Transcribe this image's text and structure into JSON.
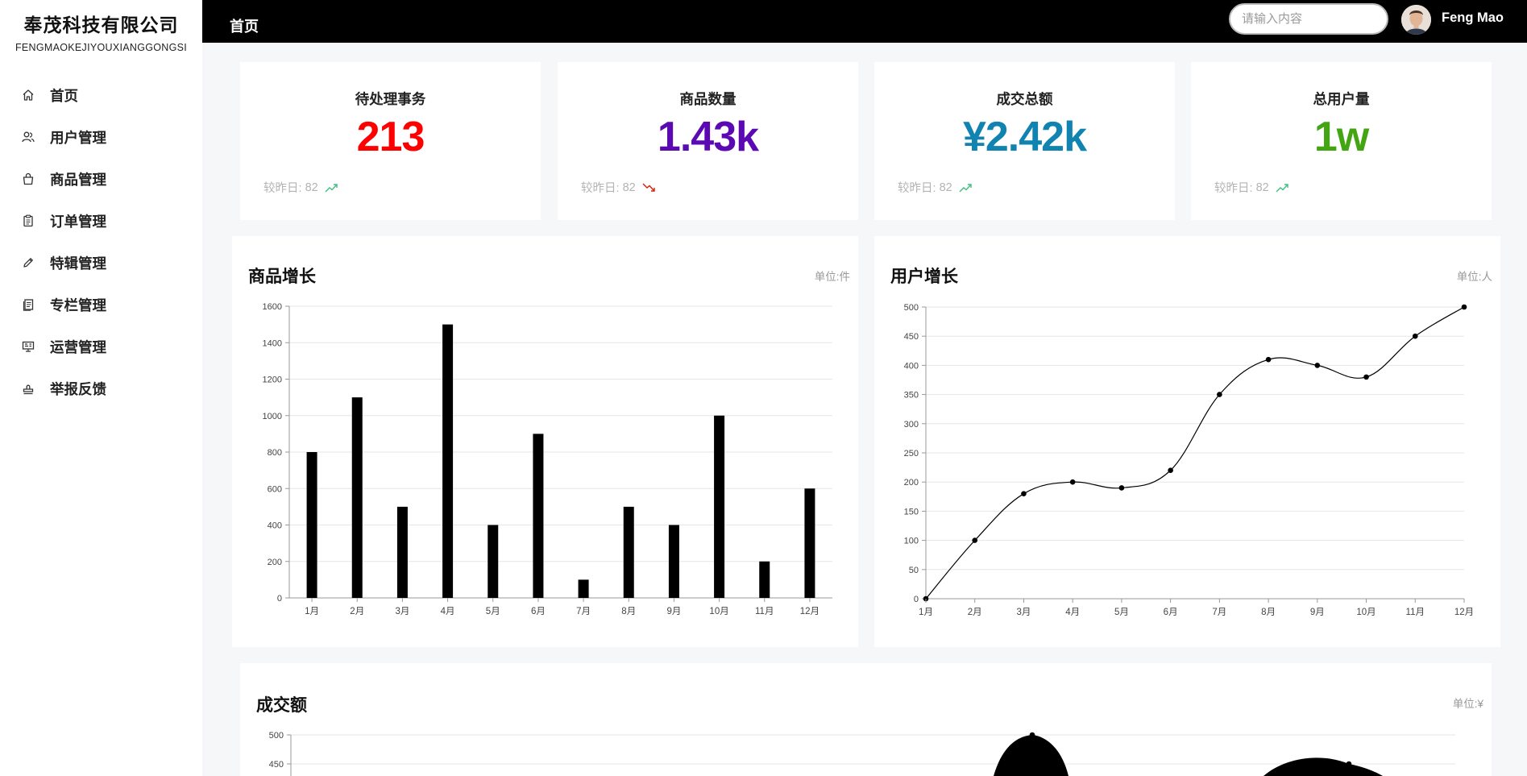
{
  "sidebar": {
    "brand_name": "奉茂科技有限公司",
    "brand_sub": "FENGMAOKEJIYOUXIANGGONGSI",
    "items": [
      {
        "label": "首页",
        "icon": "home-icon"
      },
      {
        "label": "用户管理",
        "icon": "users-icon"
      },
      {
        "label": "商品管理",
        "icon": "bag-icon"
      },
      {
        "label": "订单管理",
        "icon": "clipboard-icon"
      },
      {
        "label": "特辑管理",
        "icon": "pencil-icon"
      },
      {
        "label": "专栏管理",
        "icon": "document-icon"
      },
      {
        "label": "运营管理",
        "icon": "monitor-icon"
      },
      {
        "label": "举报反馈",
        "icon": "stamp-icon"
      }
    ]
  },
  "header": {
    "title": "首页",
    "search_placeholder": "请输入内容",
    "username": "Feng Mao"
  },
  "stats": [
    {
      "title": "待处理事务",
      "value": "213",
      "color": "#ff0000",
      "compare_label": "较昨日:",
      "compare_value": "82",
      "trend": "up"
    },
    {
      "title": "商品数量",
      "value": "1.43k",
      "color": "#5b0ab3",
      "compare_label": "较昨日:",
      "compare_value": "82",
      "trend": "down"
    },
    {
      "title": "成交总额",
      "value": "¥2.42k",
      "color": "#1183b0",
      "compare_label": "较昨日:",
      "compare_value": "82",
      "trend": "up"
    },
    {
      "title": "总用户量",
      "value": "1w",
      "color": "#43a512",
      "compare_label": "较昨日:",
      "compare_value": "82",
      "trend": "up"
    }
  ],
  "colors": {
    "trend_up": "#3fbf83",
    "trend_down": "#d81e06",
    "bar": "#000000",
    "grid": "#e6e6e6"
  },
  "panels": {
    "goods": {
      "title": "商品增长",
      "unit": "单位:件"
    },
    "users": {
      "title": "用户增长",
      "unit": "单位:人"
    },
    "sales": {
      "title": "成交额",
      "unit": "单位:¥"
    }
  },
  "chart_data": [
    {
      "type": "bar",
      "title": "商品增长",
      "categories": [
        "1月",
        "2月",
        "3月",
        "4月",
        "5月",
        "6月",
        "7月",
        "8月",
        "9月",
        "10月",
        "11月",
        "12月"
      ],
      "values": [
        800,
        1100,
        500,
        1500,
        400,
        900,
        100,
        500,
        400,
        1000,
        200,
        600
      ],
      "ylim": [
        0,
        1600
      ],
      "yticks": [
        0,
        200,
        400,
        600,
        800,
        1000,
        1200,
        1400,
        1600
      ],
      "grid": true
    },
    {
      "type": "line",
      "title": "用户增长",
      "categories": [
        "1月",
        "2月",
        "3月",
        "4月",
        "5月",
        "6月",
        "7月",
        "8月",
        "9月",
        "10月",
        "11月",
        "12月"
      ],
      "values": [
        0,
        100,
        180,
        200,
        190,
        220,
        350,
        410,
        400,
        380,
        450,
        500
      ],
      "ylim": [
        0,
        500
      ],
      "yticks": [
        0,
        50,
        100,
        150,
        200,
        250,
        300,
        350,
        400,
        450,
        500
      ],
      "grid": true,
      "smooth": true
    },
    {
      "type": "area",
      "title": "成交额",
      "ylim": [
        0,
        500
      ],
      "yticks": [
        450,
        500
      ],
      "visible_points": [
        500,
        450
      ],
      "grid": true
    }
  ]
}
